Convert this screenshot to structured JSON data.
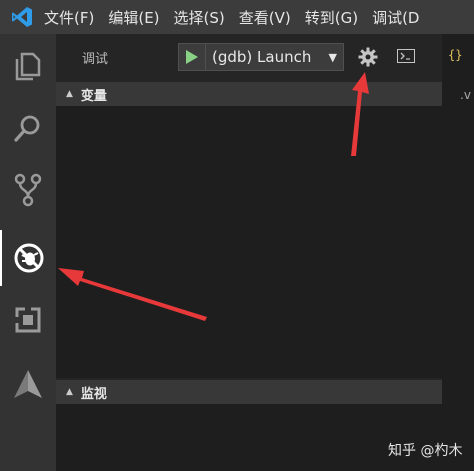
{
  "menubar": {
    "items": [
      "文件(F)",
      "编辑(E)",
      "选择(S)",
      "查看(V)",
      "转到(G)",
      "调试(D"
    ]
  },
  "activitybar": {
    "icons": [
      "explorer-icon",
      "search-icon",
      "source-control-icon",
      "debug-icon",
      "extensions-icon",
      "triangle-icon"
    ],
    "active": "debug-icon"
  },
  "debug": {
    "title": "调试",
    "launch_config": "(gdb) Launch"
  },
  "sections": {
    "variables": "变量",
    "watch": "监视"
  },
  "editor": {
    "braces": "{}",
    "ext": ".v"
  },
  "watermark": "知乎 @杓木",
  "colors": {
    "menubar_bg": "#3c3c3c",
    "activitybar_bg": "#333333",
    "sidebar_bg": "#252526",
    "play_green": "#89d185",
    "arrow_red": "#e8393a"
  }
}
